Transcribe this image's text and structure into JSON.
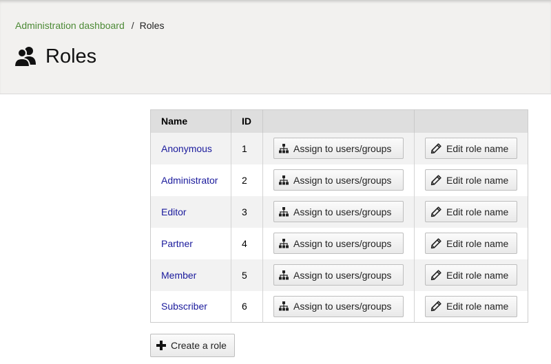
{
  "breadcrumb": {
    "parent": "Administration dashboard",
    "separator": "/",
    "current": "Roles"
  },
  "page": {
    "title": "Roles",
    "icon": "users-icon"
  },
  "table": {
    "headers": {
      "name": "Name",
      "id": "ID"
    },
    "rows": [
      {
        "name": "Anonymous",
        "id": "1",
        "assign_label": "Assign to users/groups",
        "edit_label": "Edit role name"
      },
      {
        "name": "Administrator",
        "id": "2",
        "assign_label": "Assign to users/groups",
        "edit_label": "Edit role name"
      },
      {
        "name": "Editor",
        "id": "3",
        "assign_label": "Assign to users/groups",
        "edit_label": "Edit role name"
      },
      {
        "name": "Partner",
        "id": "4",
        "assign_label": "Assign to users/groups",
        "edit_label": "Edit role name"
      },
      {
        "name": "Member",
        "id": "5",
        "assign_label": "Assign to users/groups",
        "edit_label": "Edit role name"
      },
      {
        "name": "Subscriber",
        "id": "6",
        "assign_label": "Assign to users/groups",
        "edit_label": "Edit role name"
      }
    ]
  },
  "actions": {
    "create_label": "Create a role"
  },
  "colors": {
    "breadcrumb_link": "#4c8a35",
    "role_link": "#1a1a9c",
    "header_bg": "#f2f1ef"
  }
}
